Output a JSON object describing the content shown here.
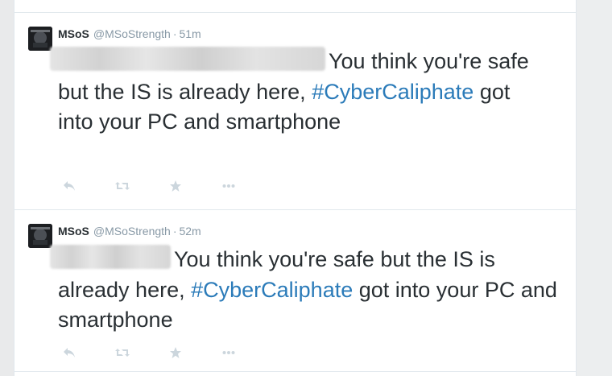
{
  "colors": {
    "link": "#2b7bb9",
    "text": "#292f33",
    "secondary": "#8899a6",
    "action_icon": "#ccd6dd"
  },
  "tweets": [
    {
      "name": "MSoS",
      "handle": "@MSoStrength",
      "separator": "·",
      "time": "51m",
      "text_before": "You think you're safe but the IS is already here, ",
      "hashtag": "#CyberCaliphate",
      "text_after": " got into your PC and smartphone",
      "actions": [
        "reply-icon",
        "retweet-icon",
        "favorite-icon",
        "more-icon"
      ]
    },
    {
      "name": "MSoS",
      "handle": "@MSoStrength",
      "separator": "·",
      "time": "52m",
      "text_before": "You think you're safe but the IS is already here, ",
      "hashtag": "#CyberCaliphate",
      "text_after": " got into your PC and smartphone",
      "actions": [
        "reply-icon",
        "retweet-icon",
        "favorite-icon",
        "more-icon"
      ]
    }
  ]
}
